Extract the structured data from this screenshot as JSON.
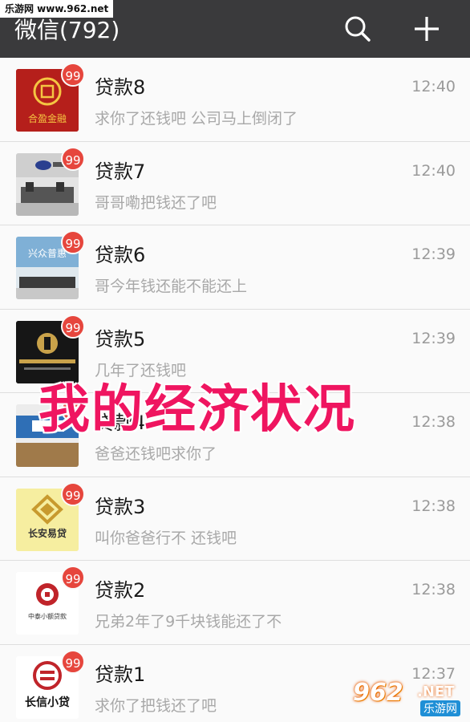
{
  "watermark_top": "乐游网 www.962.net",
  "header": {
    "title": "微信(792)",
    "search_icon": "search-icon",
    "add_icon": "plus-icon"
  },
  "chats": [
    {
      "name": "贷款8",
      "time": "12:40",
      "preview": "求你了还钱吧 公司马上倒闭了",
      "badge": "99",
      "avatar": "合盈金融"
    },
    {
      "name": "贷款7",
      "time": "12:40",
      "preview": "哥哥嘞把钱还了吧",
      "badge": "99",
      "avatar": ""
    },
    {
      "name": "贷款6",
      "time": "12:39",
      "preview": "哥今年钱还能不能还上",
      "badge": "99",
      "avatar": "兴众普惠"
    },
    {
      "name": "贷款5",
      "time": "12:39",
      "preview": "几年了还钱吧",
      "badge": "99",
      "avatar": ""
    },
    {
      "name": "贷款4",
      "time": "12:38",
      "preview": "爸爸还钱吧求你了",
      "badge": "99",
      "avatar": ""
    },
    {
      "name": "贷款3",
      "time": "12:38",
      "preview": "叫你爸爸行不   还钱吧",
      "badge": "99",
      "avatar": "长安易贷"
    },
    {
      "name": "贷款2",
      "time": "12:38",
      "preview": "兄弟2年了9千块钱能还了不",
      "badge": "99",
      "avatar": "中泰小额贷款"
    },
    {
      "name": "贷款1",
      "time": "12:37",
      "preview": "求你了把钱还了吧",
      "badge": "99",
      "avatar": "长信小贷"
    }
  ],
  "overlay": "我的经济状况",
  "logo": {
    "big": "962",
    "net": ".NET",
    "cn": "乐游网"
  },
  "colors": {
    "header_bg": "#3a3a3c",
    "badge": "#e6463d",
    "overlay": "#ef1560"
  }
}
